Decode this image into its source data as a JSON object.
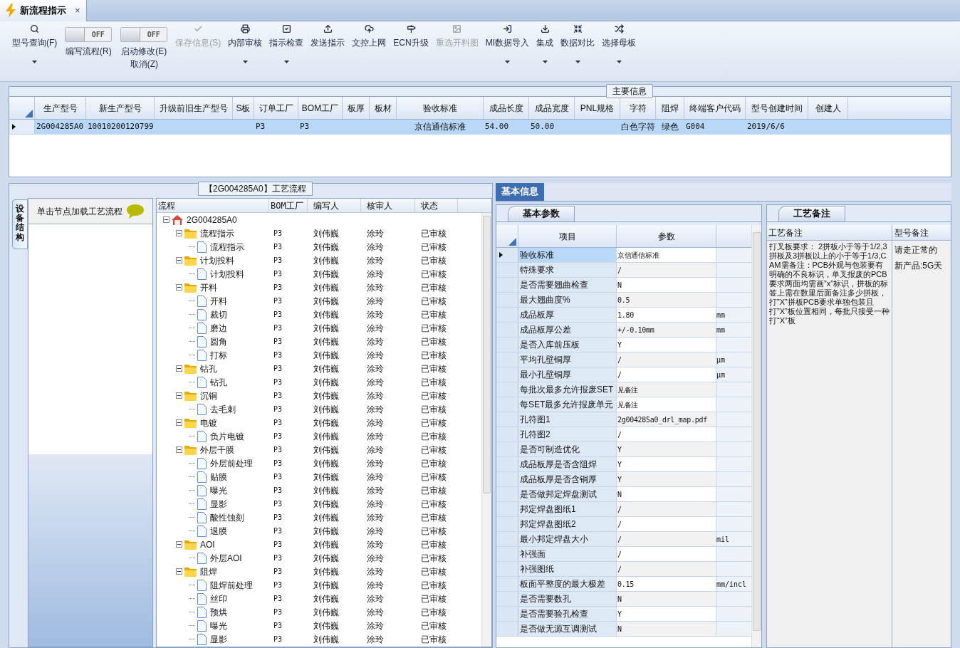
{
  "doc_tab": {
    "title": "新流程指示",
    "close": "×",
    "selected": true
  },
  "toolbar": [
    {
      "kind": "button",
      "label": "型号查询(F)",
      "disabled": false,
      "dropdown": true
    },
    {
      "kind": "toggle",
      "label": "编写流程(R)",
      "state": "OFF",
      "on": false
    },
    {
      "kind": "toggle",
      "label": "启动修改(E)",
      "sublabel": "取消(Z)",
      "state": "OFF",
      "on": false
    },
    {
      "kind": "button",
      "label": "保存信息(S)",
      "disabled": true,
      "dropdown": false
    },
    {
      "kind": "button",
      "label": "内部审核",
      "disabled": false,
      "dropdown": true
    },
    {
      "kind": "button",
      "label": "指示检查",
      "disabled": false,
      "dropdown": true
    },
    {
      "kind": "button",
      "label": "发送指示",
      "disabled": false,
      "dropdown": false
    },
    {
      "kind": "button",
      "label": "文控上网",
      "disabled": false,
      "dropdown": false
    },
    {
      "kind": "button",
      "label": "ECN升级",
      "disabled": false,
      "dropdown": false
    },
    {
      "kind": "button",
      "label": "重选开料图",
      "disabled": true,
      "dropdown": false
    },
    {
      "kind": "button",
      "label": "MI数据导入",
      "disabled": false,
      "dropdown": true
    },
    {
      "kind": "button",
      "label": "集成",
      "disabled": false,
      "dropdown": true
    },
    {
      "kind": "button",
      "label": "数据对比",
      "disabled": false,
      "dropdown": true
    },
    {
      "kind": "button",
      "label": "选择母板",
      "disabled": false,
      "dropdown": true
    }
  ],
  "main_info": {
    "title": "主要信息",
    "columns": [
      "生产型号",
      "新生产型号",
      "升级前旧生产型号",
      "S板",
      "订单工厂",
      "BOM工厂",
      "板厚",
      "板材",
      "验收标准",
      "成品长度",
      "成品宽度",
      "PNL规格",
      "字符",
      "阻焊",
      "终端客户代码",
      "型号创建时间",
      "创建人"
    ],
    "rows": [
      {
        "selected": true,
        "cells": [
          "2G004285A0",
          "10010200120799",
          "",
          "",
          "P3",
          "P3",
          "",
          "",
          "京信通信标准",
          "54.00",
          "50.00",
          "",
          "白色字符",
          "绿色",
          "G004",
          "2019/6/6",
          ""
        ]
      }
    ]
  },
  "process": {
    "title": "【2G004285A0】工艺流程",
    "side_tab": "设备结构",
    "hint": "单击节点加载工艺流程",
    "columns": [
      "流程",
      "BOM工厂",
      "编写人",
      "核审人",
      "状态"
    ],
    "tree": {
      "kind": "root",
      "label": "2G004285A0",
      "expanded": true,
      "children": [
        {
          "kind": "folder",
          "label": "流程指示",
          "expanded": true,
          "bom": "P3",
          "writer": "刘伟巍",
          "reviewer": "涂玲",
          "status": "已审核",
          "children": [
            {
              "kind": "file",
              "label": "流程指示",
              "bom": "P3",
              "writer": "刘伟巍",
              "reviewer": "涂玲",
              "status": "已审核"
            }
          ]
        },
        {
          "kind": "folder",
          "label": "计划投料",
          "expanded": true,
          "bom": "P3",
          "writer": "刘伟巍",
          "reviewer": "涂玲",
          "status": "已审核",
          "children": [
            {
              "kind": "file",
              "label": "计划投料",
              "bom": "P3",
              "writer": "刘伟巍",
              "reviewer": "涂玲",
              "status": "已审核"
            }
          ]
        },
        {
          "kind": "folder",
          "label": "开料",
          "expanded": true,
          "bom": "P3",
          "writer": "刘伟巍",
          "reviewer": "涂玲",
          "status": "已审核",
          "children": [
            {
              "kind": "file",
              "label": "开料",
              "bom": "P3",
              "writer": "刘伟巍",
              "reviewer": "涂玲",
              "status": "已审核"
            },
            {
              "kind": "file",
              "label": "裁切",
              "bom": "P3",
              "writer": "刘伟巍",
              "reviewer": "涂玲",
              "status": "已审核"
            },
            {
              "kind": "file",
              "label": "磨边",
              "bom": "P3",
              "writer": "刘伟巍",
              "reviewer": "涂玲",
              "status": "已审核"
            },
            {
              "kind": "file",
              "label": "圆角",
              "bom": "P3",
              "writer": "刘伟巍",
              "reviewer": "涂玲",
              "status": "已审核"
            },
            {
              "kind": "file",
              "label": "打标",
              "bom": "P3",
              "writer": "刘伟巍",
              "reviewer": "涂玲",
              "status": "已审核"
            }
          ]
        },
        {
          "kind": "folder",
          "label": "钻孔",
          "expanded": true,
          "bom": "P3",
          "writer": "刘伟巍",
          "reviewer": "涂玲",
          "status": "已审核",
          "children": [
            {
              "kind": "file",
              "label": "钻孔",
              "bom": "P3",
              "writer": "刘伟巍",
              "reviewer": "涂玲",
              "status": "已审核"
            }
          ]
        },
        {
          "kind": "folder",
          "label": "沉铜",
          "expanded": true,
          "bom": "P3",
          "writer": "刘伟巍",
          "reviewer": "涂玲",
          "status": "已审核",
          "children": [
            {
              "kind": "file",
              "label": "去毛刺",
              "bom": "P3",
              "writer": "刘伟巍",
              "reviewer": "涂玲",
              "status": "已审核"
            }
          ]
        },
        {
          "kind": "folder",
          "label": "电镀",
          "expanded": true,
          "bom": "P3",
          "writer": "刘伟巍",
          "reviewer": "涂玲",
          "status": "已审核",
          "children": [
            {
              "kind": "file",
              "label": "负片电镀",
              "bom": "P3",
              "writer": "刘伟巍",
              "reviewer": "涂玲",
              "status": "已审核"
            }
          ]
        },
        {
          "kind": "folder",
          "label": "外层干膜",
          "expanded": true,
          "bom": "P3",
          "writer": "刘伟巍",
          "reviewer": "涂玲",
          "status": "已审核",
          "children": [
            {
              "kind": "file",
              "label": "外层前处理",
              "bom": "P3",
              "writer": "刘伟巍",
              "reviewer": "涂玲",
              "status": "已审核"
            },
            {
              "kind": "file",
              "label": "贴膜",
              "bom": "P3",
              "writer": "刘伟巍",
              "reviewer": "涂玲",
              "status": "已审核"
            },
            {
              "kind": "file",
              "label": "曝光",
              "bom": "P3",
              "writer": "刘伟巍",
              "reviewer": "涂玲",
              "status": "已审核"
            },
            {
              "kind": "file",
              "label": "显影",
              "bom": "P3",
              "writer": "刘伟巍",
              "reviewer": "涂玲",
              "status": "已审核"
            },
            {
              "kind": "file",
              "label": "酸性蚀刻",
              "bom": "P3",
              "writer": "刘伟巍",
              "reviewer": "涂玲",
              "status": "已审核"
            },
            {
              "kind": "file",
              "label": "退膜",
              "bom": "P3",
              "writer": "刘伟巍",
              "reviewer": "涂玲",
              "status": "已审核"
            }
          ]
        },
        {
          "kind": "folder",
          "label": "AOI",
          "expanded": true,
          "bom": "P3",
          "writer": "刘伟巍",
          "reviewer": "涂玲",
          "status": "已审核",
          "children": [
            {
              "kind": "file",
              "label": "外层AOI",
              "bom": "P3",
              "writer": "刘伟巍",
              "reviewer": "涂玲",
              "status": "已审核"
            }
          ]
        },
        {
          "kind": "folder",
          "label": "阻焊",
          "expanded": true,
          "bom": "P3",
          "writer": "刘伟巍",
          "reviewer": "涂玲",
          "status": "已审核",
          "children": [
            {
              "kind": "file",
              "label": "阻焊前处理",
              "bom": "P3",
              "writer": "刘伟巍",
              "reviewer": "涂玲",
              "status": "已审核"
            },
            {
              "kind": "file",
              "label": "丝印",
              "bom": "P3",
              "writer": "刘伟巍",
              "reviewer": "涂玲",
              "status": "已审核"
            },
            {
              "kind": "file",
              "label": "预烘",
              "bom": "P3",
              "writer": "刘伟巍",
              "reviewer": "涂玲",
              "status": "已审核"
            },
            {
              "kind": "file",
              "label": "曝光",
              "bom": "P3",
              "writer": "刘伟巍",
              "reviewer": "涂玲",
              "status": "已审核"
            },
            {
              "kind": "file",
              "label": "显影",
              "bom": "P3",
              "writer": "刘伟巍",
              "reviewer": "涂玲",
              "status": "已审核"
            }
          ]
        }
      ]
    }
  },
  "basic_info": {
    "tab": "基本信息",
    "subtab": "基本参数",
    "columns": [
      "项目",
      "参数"
    ],
    "rows": [
      {
        "item": "验收标准",
        "value": "京信通信标准",
        "unit": "",
        "selected": true
      },
      {
        "item": "特殊要求",
        "value": "/",
        "unit": "",
        "selected": false
      },
      {
        "item": "是否需要翘曲检查",
        "value": "N",
        "unit": "",
        "selected": false
      },
      {
        "item": "最大翘曲度%",
        "value": "0.5",
        "unit": "",
        "selected": false
      },
      {
        "item": "成品板厚",
        "value": "1.80",
        "unit": "mm",
        "selected": false
      },
      {
        "item": "成品板厚公差",
        "value": "+/-0.10mm",
        "unit": "mm",
        "selected": false
      },
      {
        "item": "是否入库前压板",
        "value": "Y",
        "unit": "",
        "selected": false
      },
      {
        "item": "平均孔壁铜厚",
        "value": "/",
        "unit": "μm",
        "selected": false
      },
      {
        "item": "最小孔壁铜厚",
        "value": "/",
        "unit": "μm",
        "selected": false
      },
      {
        "item": "每批次最多允许报废SET",
        "value": "见备注",
        "unit": "",
        "selected": false
      },
      {
        "item": "每SET最多允许报废单元",
        "value": "见备注",
        "unit": "",
        "selected": false
      },
      {
        "item": "孔符图1",
        "value": "2g004285a0_drl_map.pdf",
        "unit": "",
        "selected": false
      },
      {
        "item": "孔符图2",
        "value": "/",
        "unit": "",
        "selected": false
      },
      {
        "item": "是否可制造优化",
        "value": "Y",
        "unit": "",
        "selected": false
      },
      {
        "item": "成品板厚是否含阻焊",
        "value": "Y",
        "unit": "",
        "selected": false
      },
      {
        "item": "成品板厚是否含铜厚",
        "value": "Y",
        "unit": "",
        "selected": false
      },
      {
        "item": "是否做邦定焊盘测试",
        "value": "N",
        "unit": "",
        "selected": false
      },
      {
        "item": "邦定焊盘图纸1",
        "value": "/",
        "unit": "",
        "selected": false
      },
      {
        "item": "邦定焊盘图纸2",
        "value": "/",
        "unit": "",
        "selected": false
      },
      {
        "item": "最小邦定焊盘大小",
        "value": "/",
        "unit": "mil",
        "selected": false
      },
      {
        "item": "补强面",
        "value": "/",
        "unit": "",
        "selected": false
      },
      {
        "item": "补强图纸",
        "value": "/",
        "unit": "",
        "selected": false
      },
      {
        "item": "板面平整度的最大极差",
        "value": "0.15",
        "unit": "mm/incl",
        "selected": false
      },
      {
        "item": "是否需要数孔",
        "value": "N",
        "unit": "",
        "selected": false
      },
      {
        "item": "是否需要验孔检查",
        "value": "Y",
        "unit": "",
        "selected": false
      },
      {
        "item": "是否做无源互调测试",
        "value": "N",
        "unit": "",
        "selected": false
      }
    ]
  },
  "notes": {
    "tab": "工艺备注",
    "columns": [
      "工艺备注",
      "型号备注"
    ],
    "process_note": "打叉板要求： 2拼板小于等于1/2,3拼板及3拼板以上的小于等于1/3,CAM需备注：PCB外观与包装要有明确的不良标识，单叉报废的PCB要求两面均需画”x”标识，拼板的标签上需在数里后面备注多少拼板，打”X”拼板PCB要求单独包装且打”X”板位置相同，每批只接受一种打“X”板",
    "model_notes": [
      "请走正常的",
      "新产品:5G天"
    ]
  }
}
